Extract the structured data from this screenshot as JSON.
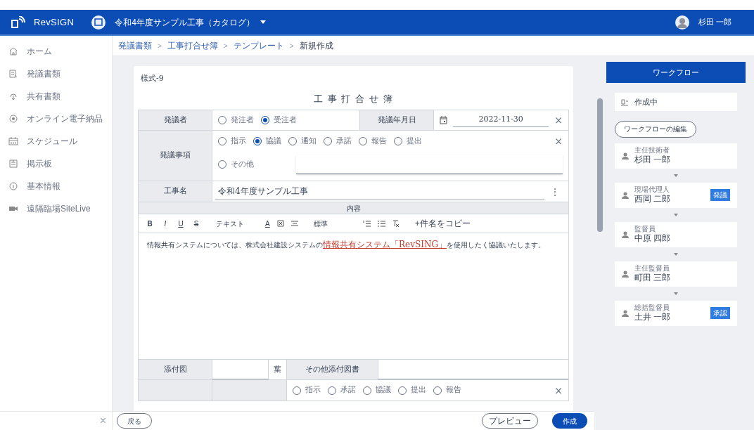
{
  "header": {
    "brand": "RevSIGN",
    "project": "令和4年度サンプル工事（カタログ）",
    "user": "杉田 一郎"
  },
  "sidebar": {
    "items": [
      {
        "label": "ホーム"
      },
      {
        "label": "発議書類"
      },
      {
        "label": "共有書類"
      },
      {
        "label": "オンライン電子納品"
      },
      {
        "label": "スケジュール"
      },
      {
        "label": "掲示板"
      },
      {
        "label": "基本情報"
      },
      {
        "label": "遠隔臨場SiteLive"
      }
    ],
    "close": "×"
  },
  "breadcrumb": [
    "発議書類",
    "工事打合せ簿",
    "テンプレート",
    "新規作成"
  ],
  "breadcrumb_separators": [
    ">",
    ">",
    ">"
  ],
  "form": {
    "form_no": "様式-9",
    "title": "工 事 打 合 せ 簿",
    "proposer": {
      "label": "発議者",
      "options": [
        {
          "label": "発注者",
          "selected": false
        },
        {
          "label": "受注者",
          "selected": true
        }
      ]
    },
    "date": {
      "label": "発議年月日",
      "value": "2022-11-30",
      "clear": "×"
    },
    "matter": {
      "label": "発議事項",
      "options": [
        {
          "label": "指示",
          "selected": false
        },
        {
          "label": "協議",
          "selected": true
        },
        {
          "label": "通知",
          "selected": false
        },
        {
          "label": "承諾",
          "selected": false
        },
        {
          "label": "報告",
          "selected": false
        },
        {
          "label": "提出",
          "selected": false
        }
      ],
      "clear": "×",
      "other": {
        "label": "その他",
        "selected": false
      }
    },
    "project_name": {
      "label": "工事名",
      "value": "令和4年度サンプル工事",
      "more": "⋮"
    },
    "content": {
      "label": "内容",
      "format_buttons": [
        "B",
        "I",
        "U",
        "S"
      ],
      "text_style": "テキスト",
      "font_color": "A",
      "size": "標準",
      "copy": "+件名をコピー",
      "body": [
        {
          "kind": "plain",
          "text": "情報共有システムについては、株式会社建設システムの"
        },
        {
          "kind": "highlight",
          "text": "情報共有システム「RevSING」"
        },
        {
          "kind": "plain",
          "text": "を使用したく協議いたします。"
        }
      ]
    },
    "attachments": {
      "label": "添付図",
      "unit": "葉",
      "other_label": "その他添付図書"
    },
    "next_row": {
      "options": [
        {
          "label": "指示",
          "selected": false
        },
        {
          "label": "承諾",
          "selected": false
        },
        {
          "label": "協議",
          "selected": false
        },
        {
          "label": "提出",
          "selected": false
        },
        {
          "label": "報告",
          "selected": false
        }
      ],
      "clear": "×"
    }
  },
  "footer": {
    "back": "戻る",
    "preview": "プレビュー",
    "create": "作成"
  },
  "workflow": {
    "title": "ワークフロー",
    "status": "作成中",
    "edit": "ワークフローの編集",
    "steps": [
      {
        "role": "主任技術者",
        "name": "杉田 一郎"
      },
      {
        "role": "現場代理人",
        "name": "西岡 二郎",
        "badge": "発議"
      },
      {
        "role": "監督員",
        "name": "中原 四郎"
      },
      {
        "role": "主任監督員",
        "name": "町田 三郎"
      },
      {
        "role": "総括監督員",
        "name": "土井 一郎",
        "badge": "承認"
      }
    ]
  }
}
